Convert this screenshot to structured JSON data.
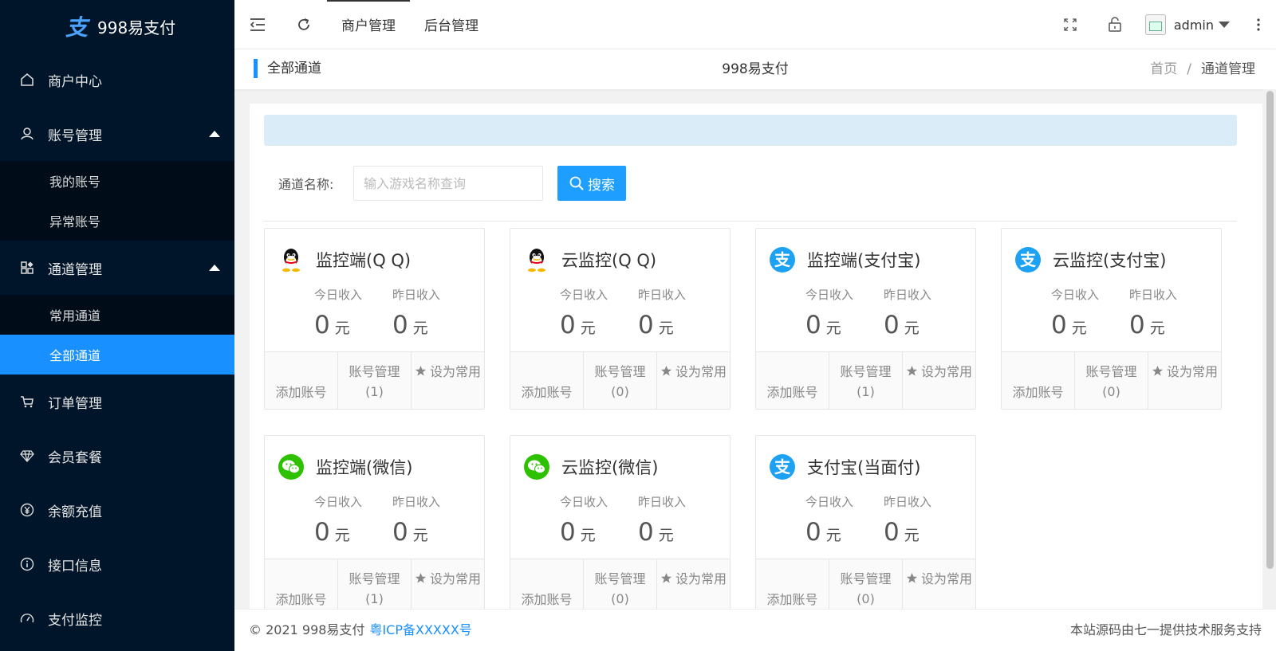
{
  "app": {
    "name": "998易支付",
    "accent": "#1890ff"
  },
  "sidebar": {
    "items": [
      {
        "label": "商户中心",
        "icon": "home-icon"
      },
      {
        "label": "账号管理",
        "icon": "user-icon",
        "expanded": true,
        "children": [
          {
            "label": "我的账号"
          },
          {
            "label": "异常账号"
          }
        ]
      },
      {
        "label": "通道管理",
        "icon": "apps-icon",
        "expanded": true,
        "children": [
          {
            "label": "常用通道"
          },
          {
            "label": "全部通道",
            "active": true
          }
        ]
      },
      {
        "label": "订单管理",
        "icon": "cart-icon"
      },
      {
        "label": "会员套餐",
        "icon": "diamond-icon"
      },
      {
        "label": "余额充值",
        "icon": "yen-icon"
      },
      {
        "label": "接口信息",
        "icon": "info-icon"
      },
      {
        "label": "支付监控",
        "icon": "dashboard-icon"
      }
    ]
  },
  "header": {
    "tabs": [
      {
        "label": "商户管理",
        "active": true
      },
      {
        "label": "后台管理"
      }
    ],
    "user": "admin"
  },
  "subheader": {
    "title": "全部通道",
    "center": "998易支付",
    "breadcrumb": [
      "首页",
      "通道管理"
    ],
    "breadcrumb_sep": "/"
  },
  "search": {
    "label": "通道名称:",
    "placeholder": "输入游戏名称查询",
    "button": "搜索"
  },
  "cards": [
    {
      "title": "监控端(Q Q)",
      "icon": "qq-icon",
      "today_label": "今日收入",
      "today": "0",
      "yesterday_label": "昨日收入",
      "yesterday": "0",
      "unit": "元",
      "add": "添加账号",
      "manage": "账号管理",
      "count": "(1)",
      "fav": "设为常用"
    },
    {
      "title": "云监控(Q Q)",
      "icon": "qq-icon",
      "today_label": "今日收入",
      "today": "0",
      "yesterday_label": "昨日收入",
      "yesterday": "0",
      "unit": "元",
      "add": "添加账号",
      "manage": "账号管理",
      "count": "(0)",
      "fav": "设为常用"
    },
    {
      "title": "监控端(支付宝)",
      "icon": "alipay-icon",
      "today_label": "今日收入",
      "today": "0",
      "yesterday_label": "昨日收入",
      "yesterday": "0",
      "unit": "元",
      "add": "添加账号",
      "manage": "账号管理",
      "count": "(1)",
      "fav": "设为常用"
    },
    {
      "title": "云监控(支付宝)",
      "icon": "alipay-icon",
      "today_label": "今日收入",
      "today": "0",
      "yesterday_label": "昨日收入",
      "yesterday": "0",
      "unit": "元",
      "add": "添加账号",
      "manage": "账号管理",
      "count": "(0)",
      "fav": "设为常用"
    },
    {
      "title": "监控端(微信)",
      "icon": "wechat-icon",
      "today_label": "今日收入",
      "today": "0",
      "yesterday_label": "昨日收入",
      "yesterday": "0",
      "unit": "元",
      "add": "添加账号",
      "manage": "账号管理",
      "count": "(1)",
      "fav": "设为常用"
    },
    {
      "title": "云监控(微信)",
      "icon": "wechat-icon",
      "today_label": "今日收入",
      "today": "0",
      "yesterday_label": "昨日收入",
      "yesterday": "0",
      "unit": "元",
      "add": "添加账号",
      "manage": "账号管理",
      "count": "(0)",
      "fav": "设为常用"
    },
    {
      "title": "支付宝(当面付)",
      "icon": "alipay-icon",
      "today_label": "今日收入",
      "today": "0",
      "yesterday_label": "昨日收入",
      "yesterday": "0",
      "unit": "元",
      "add": "添加账号",
      "manage": "账号管理",
      "count": "(0)",
      "fav": "设为常用"
    }
  ],
  "footer": {
    "copyright": "© 2021 998易支付",
    "icp": "粤ICP备XXXXX号",
    "right": "本站源码由七一提供技术服务支持"
  }
}
